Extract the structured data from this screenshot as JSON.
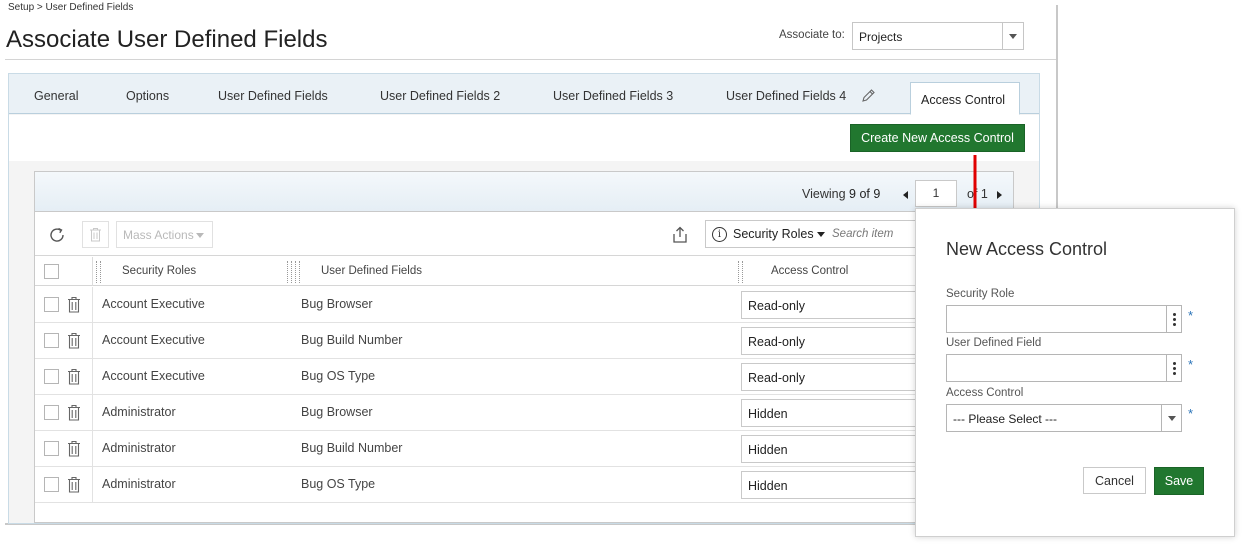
{
  "breadcrumb": "Setup > User Defined Fields",
  "page_title": "Associate User Defined Fields",
  "associate": {
    "label": "Associate to:",
    "value": "Projects"
  },
  "tabs": [
    {
      "label": "General"
    },
    {
      "label": "Options"
    },
    {
      "label": "User Defined Fields"
    },
    {
      "label": "User Defined Fields 2"
    },
    {
      "label": "User Defined Fields 3"
    },
    {
      "label": "User Defined Fields 4"
    },
    {
      "label": "Access Control",
      "active": true
    }
  ],
  "create_button": "Create New Access Control",
  "pager": {
    "viewing_label": "Viewing",
    "viewing_value": "9 of 9",
    "page": "1",
    "of_label": "of 1"
  },
  "toolbar": {
    "mass_actions": "Mass Actions",
    "filter_label": "Security Roles",
    "filter_placeholder": "Search item"
  },
  "columns": [
    "Security Roles",
    "User Defined Fields",
    "Access Control"
  ],
  "rows": [
    {
      "role": "Account Executive",
      "field": "Bug Browser",
      "access": "Read-only"
    },
    {
      "role": "Account Executive",
      "field": "Bug Build Number",
      "access": "Read-only"
    },
    {
      "role": "Account Executive",
      "field": "Bug OS Type",
      "access": "Read-only"
    },
    {
      "role": "Administrator",
      "field": "Bug Browser",
      "access": "Hidden"
    },
    {
      "role": "Administrator",
      "field": "Bug Build Number",
      "access": "Hidden"
    },
    {
      "role": "Administrator",
      "field": "Bug OS Type",
      "access": "Hidden"
    }
  ],
  "dialog": {
    "title": "New Access Control",
    "security_role_label": "Security Role",
    "security_role_value": "",
    "udf_label": "User Defined Field",
    "udf_value": "",
    "access_label": "Access Control",
    "access_value": "--- Please Select ---",
    "required_mark": "*",
    "cancel": "Cancel",
    "save": "Save"
  },
  "colors": {
    "primary_green": "#21772f",
    "annotation_arrow": "#e00000",
    "required": "#2a73b8"
  }
}
